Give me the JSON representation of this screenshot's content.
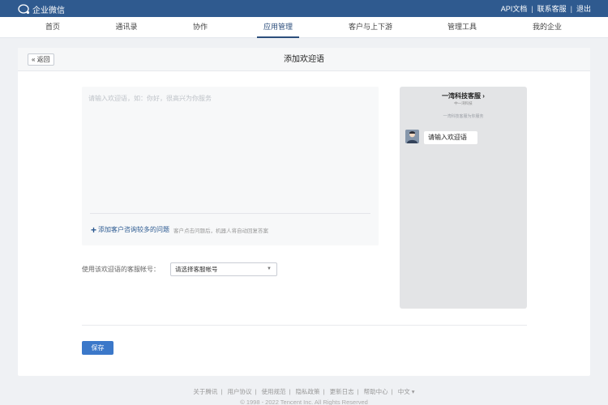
{
  "topbar": {
    "brand": "企业微信",
    "links": [
      "API文档",
      "联系客服",
      "退出"
    ],
    "separator": "|"
  },
  "nav": {
    "items": [
      "首页",
      "通讯录",
      "协作",
      "应用管理",
      "客户与上下游",
      "管理工具",
      "我的企业"
    ],
    "active": "应用管理"
  },
  "page": {
    "back": "« 返回",
    "title": "添加欢迎语"
  },
  "editor": {
    "placeholder": "请输入欢迎语，如：你好，很高兴为你服务",
    "faq_link": "添加客户咨询较多的问题",
    "faq_hint": "客户点击问题后，机器人将自动回复答案"
  },
  "account": {
    "label": "使用该欢迎语的客服帐号：",
    "selected": "请选择客服帐号",
    "caret": "▼"
  },
  "preview": {
    "name": "一湾科技客服 ›",
    "sub": "中一湾科技",
    "desc": "一湾科技客服为你服务",
    "bubble": "请输入欢迎语"
  },
  "actions": {
    "save": "保存"
  },
  "footer": {
    "links": [
      "关于腾讯",
      "用户协议",
      "使用规范",
      "隐私政策",
      "更新日志",
      "帮助中心",
      "中文 ▾"
    ],
    "copyright": "© 1998 - 2022 Tencent Inc. All Rights Reserved"
  },
  "colors": {
    "topbar": "#2f5a8f",
    "accent": "#2c4e7c",
    "primary_button": "#3b78c9"
  }
}
